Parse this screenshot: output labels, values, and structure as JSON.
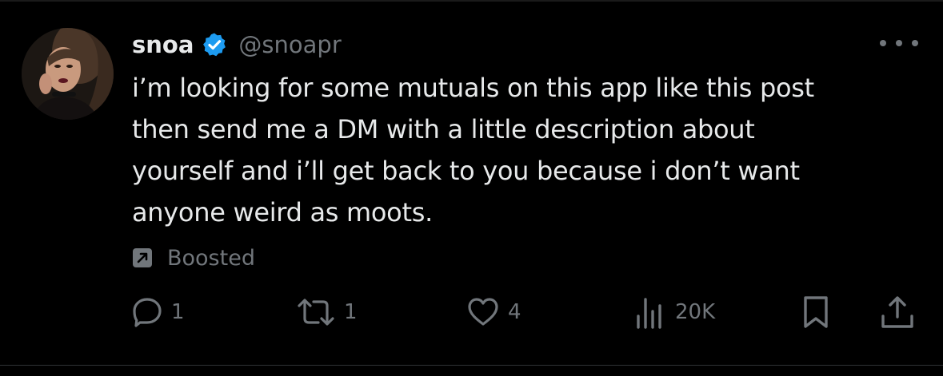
{
  "tweet": {
    "display_name": "snoa",
    "handle": "@snoapr",
    "verified": true,
    "text": "i’m looking for some mutuals on this app like this post\nthen send me a DM with a little description about\nyourself and i’ll get back to you because i don’t want\nanyone weird as moots.",
    "promoted_label": "Boosted"
  },
  "actions": {
    "replies": "1",
    "reposts": "1",
    "likes": "4",
    "views": "20K"
  },
  "icons": {
    "more": "more-horizontal-icon",
    "verified": "verified-badge-icon",
    "boosted": "boosted-arrow-icon",
    "reply": "reply-bubble-icon",
    "repost": "repost-arrows-icon",
    "like": "heart-icon",
    "views": "views-bars-icon",
    "bookmark": "bookmark-icon",
    "share": "share-upload-icon"
  },
  "colors": {
    "background": "#000000",
    "primary_text": "#e7e9ea",
    "secondary_text": "#71767b",
    "verified_blue": "#1d9bf0"
  }
}
